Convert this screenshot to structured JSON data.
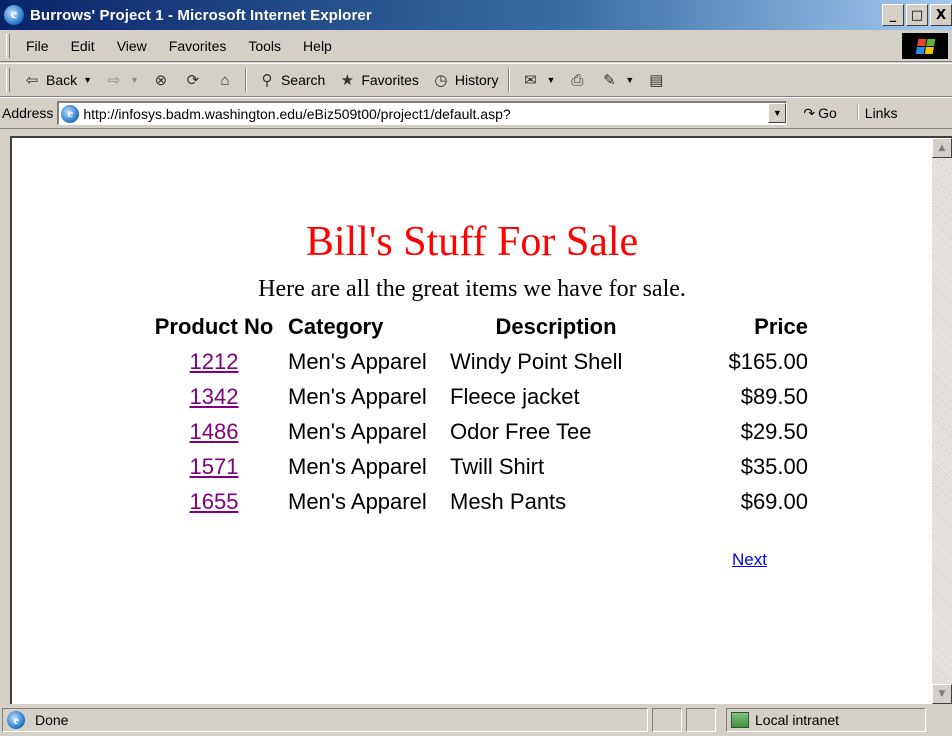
{
  "window": {
    "title": "Burrows' Project 1 - Microsoft Internet Explorer",
    "controls": [
      "_",
      "□",
      "X"
    ]
  },
  "menu": [
    "File",
    "Edit",
    "View",
    "Favorites",
    "Tools",
    "Help"
  ],
  "toolbar": {
    "back": "Back",
    "search": "Search",
    "favorites": "Favorites",
    "history": "History"
  },
  "address": {
    "label": "Address",
    "url": "http://infosys.badm.washington.edu/eBiz509t00/project1/default.asp?",
    "go": "Go",
    "links": "Links"
  },
  "page": {
    "title": "Bill's Stuff For Sale",
    "intro": "Here are all the great items we have for sale.",
    "columns": [
      "Product No",
      "Category",
      "Description",
      "Price"
    ],
    "rows": [
      {
        "no": "1212",
        "category": "Men's Apparel",
        "description": "Windy Point Shell",
        "price": "$165.00"
      },
      {
        "no": "1342",
        "category": "Men's Apparel",
        "description": "Fleece jacket",
        "price": "$89.50"
      },
      {
        "no": "1486",
        "category": "Men's Apparel",
        "description": "Odor Free Tee",
        "price": "$29.50"
      },
      {
        "no": "1571",
        "category": "Men's Apparel",
        "description": "Twill Shirt",
        "price": "$35.00"
      },
      {
        "no": "1655",
        "category": "Men's Apparel",
        "description": "Mesh Pants",
        "price": "$69.00"
      }
    ],
    "next": "Next"
  },
  "status": {
    "text": "Done",
    "zone": "Local intranet"
  },
  "colors": {
    "title_red": "#ff0000",
    "visited_link": "#800080",
    "link": "#0000ee",
    "chrome": "#d4d0c8"
  }
}
